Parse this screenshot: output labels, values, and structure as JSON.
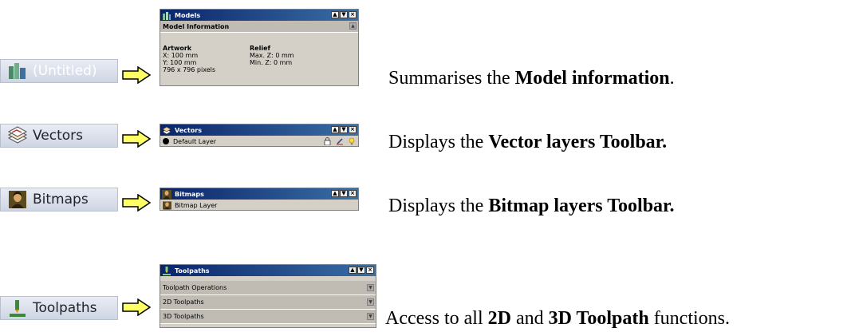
{
  "rows": {
    "models": {
      "tab_label": "(Untitled)",
      "panel_title": "Models",
      "section": "Model Information",
      "artwork_heading": "Artwork",
      "artwork_lines": [
        "X: 100 mm",
        "Y: 100 mm",
        "796 x 796 pixels"
      ],
      "relief_heading": "Relief",
      "relief_lines": [
        "Max. Z: 0 mm",
        "Min. Z: 0 mm"
      ],
      "desc_pre": "Summarises the ",
      "desc_bold": "Model information",
      "desc_post": "."
    },
    "vectors": {
      "tab_label": "Vectors",
      "panel_title": "Vectors",
      "layer": "Default Layer",
      "desc_pre": "Displays the ",
      "desc_bold": "Vector layers Toolbar."
    },
    "bitmaps": {
      "tab_label": "Bitmaps",
      "panel_title": "Bitmaps",
      "layer": "Bitmap Layer",
      "desc_pre": "Displays the ",
      "desc_bold": "Bitmap layers Toolbar."
    },
    "toolpaths": {
      "tab_label": "Toolpaths",
      "panel_title": "Toolpaths",
      "sections": [
        "Toolpath Operations",
        "2D Toolpaths",
        "3D Toolpaths"
      ],
      "desc_pre": "Access to all ",
      "desc_bold1": "2D",
      "desc_mid": " and ",
      "desc_bold2": "3D Toolpath",
      "desc_post": " functions."
    }
  },
  "icons": {
    "models_tab": "models-icon",
    "vectors_tab": "layers-icon",
    "bitmaps_tab": "portrait-icon",
    "toolpaths_tab": "toolpath-icon",
    "arrow": "right-arrow-icon"
  },
  "colors": {
    "arrow_fill": "#ffff66",
    "title_bar": "#0a246a",
    "panel_bg": "#d4d0c8"
  }
}
